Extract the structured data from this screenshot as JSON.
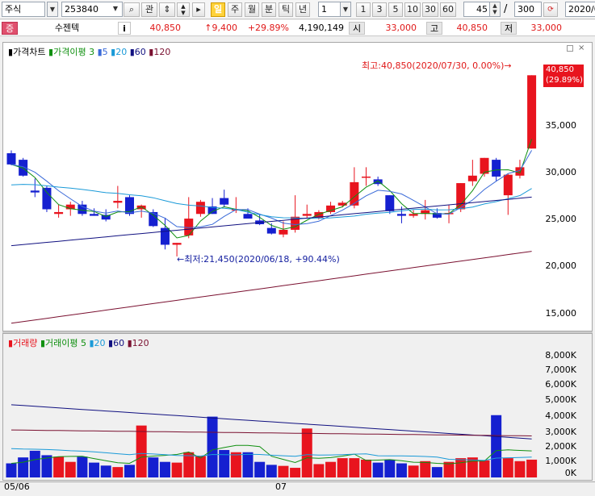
{
  "toolbar": {
    "market": "주식",
    "code": "253840",
    "btn_gwan": "관",
    "periods": [
      "일",
      "주",
      "월",
      "분",
      "틱",
      "년"
    ],
    "interval_value": "1",
    "minute_options": [
      "1",
      "3",
      "5",
      "10",
      "30",
      "60"
    ],
    "count_value": "45",
    "slash": "/",
    "total_value": "300",
    "date_value": "2020/0"
  },
  "info": {
    "tag": "증",
    "name": "수젠텍",
    "i_label": "i",
    "price": "40,850",
    "change": "↑9,400",
    "change_pct": "+29.89%",
    "volume": "4,190,149",
    "open_label": "시",
    "open": "33,000",
    "high_label": "고",
    "high": "40,850",
    "low_label": "저",
    "low": "33,000"
  },
  "price_panel": {
    "legend_title": "가격차트",
    "legend_ma": "가격이평",
    "legend_periods": [
      "3",
      "5",
      "20",
      "60",
      "120"
    ],
    "high_annotation": "최고:40,850(2020/07/30, 0.00%)→",
    "low_annotation": "←최저:21,450(2020/06/18, +90.44%)",
    "current_price_tag": "40,850",
    "current_pct_tag": "(29.89%)",
    "y_ticks": [
      "35,000",
      "30,000",
      "25,000",
      "20,000",
      "15,000"
    ]
  },
  "volume_panel": {
    "legend_title": "거래량",
    "legend_ma": "거래이평",
    "legend_periods": [
      "5",
      "20",
      "60",
      "120"
    ],
    "y_ticks": [
      "8,000K",
      "7,000K",
      "6,000K",
      "5,000K",
      "4,000K",
      "3,000K",
      "2,000K",
      "1,000K",
      "0K"
    ]
  },
  "x_axis": {
    "labels": [
      "05/06",
      "07"
    ]
  },
  "colors": {
    "up": "#e8141e",
    "down": "#1520d0",
    "ma3": "#109010",
    "ma5": "#3a6ad8",
    "ma20": "#1a9ad8",
    "ma60": "#101080",
    "ma120": "#7a1030"
  },
  "chart_data": {
    "type": "candlestick",
    "title": "가격차트",
    "ylim": [
      13500,
      42000
    ],
    "x": [
      "05/06",
      "",
      "",
      "",
      "",
      "",
      "",
      "",
      "",
      "",
      "",
      "",
      "",
      "",
      "",
      "",
      "",
      "",
      "",
      "",
      "",
      "",
      "",
      "",
      "07",
      "",
      "",
      "",
      "",
      "",
      "",
      "",
      "",
      "",
      "",
      "",
      "",
      "",
      "",
      "",
      "",
      "",
      "",
      "",
      ""
    ],
    "ohlc": [
      [
        32500,
        32800,
        31200,
        31300
      ],
      [
        31800,
        32000,
        30000,
        30100
      ],
      [
        28500,
        29800,
        27800,
        28300
      ],
      [
        28800,
        29000,
        26200,
        26500
      ],
      [
        26000,
        27000,
        25600,
        26200
      ],
      [
        26500,
        27300,
        25800,
        27000
      ],
      [
        27000,
        27400,
        25800,
        26000
      ],
      [
        26000,
        26600,
        25800,
        25800
      ],
      [
        25900,
        26500,
        25200,
        25400
      ],
      [
        27200,
        29000,
        26600,
        27400
      ],
      [
        27800,
        28000,
        25800,
        26000
      ],
      [
        26500,
        27000,
        25600,
        26900
      ],
      [
        26200,
        26500,
        24600,
        24700
      ],
      [
        24500,
        25600,
        22200,
        22700
      ],
      [
        22700,
        22900,
        21450,
        22900
      ],
      [
        23700,
        27800,
        23400,
        25500
      ],
      [
        26000,
        27500,
        25700,
        27300
      ],
      [
        26800,
        27700,
        26000,
        26000
      ],
      [
        27700,
        28600,
        26700,
        27000
      ],
      [
        26400,
        27800,
        26100,
        26500
      ],
      [
        26000,
        26600,
        25500,
        25500
      ],
      [
        25300,
        26000,
        24800,
        24900
      ],
      [
        24500,
        25000,
        23800,
        23900
      ],
      [
        23800,
        25200,
        23500,
        24300
      ],
      [
        24300,
        28000,
        24000,
        25700
      ],
      [
        25800,
        27000,
        25600,
        26000
      ],
      [
        25600,
        26400,
        25400,
        26200
      ],
      [
        26200,
        27300,
        26000,
        26900
      ],
      [
        26900,
        27400,
        26700,
        27200
      ],
      [
        26900,
        31000,
        26600,
        29400
      ],
      [
        30000,
        31000,
        29000,
        30000
      ],
      [
        29700,
        30000,
        29000,
        29200
      ],
      [
        28000,
        28000,
        26000,
        26300
      ],
      [
        26000,
        26800,
        25000,
        25800
      ],
      [
        25800,
        26400,
        25600,
        26000
      ],
      [
        26000,
        27500,
        25400,
        26400
      ],
      [
        26100,
        26600,
        25500,
        25600
      ],
      [
        26000,
        27000,
        25000,
        26100
      ],
      [
        26500,
        29300,
        26200,
        29300
      ],
      [
        29500,
        31800,
        29000,
        30100
      ],
      [
        30300,
        32000,
        30000,
        32000
      ],
      [
        31800,
        32000,
        29500,
        30000
      ],
      [
        28000,
        30300,
        25900,
        30200
      ],
      [
        30100,
        31800,
        29800,
        31000
      ],
      [
        33000,
        40850,
        33000,
        40850
      ]
    ],
    "volume": [
      950,
      1350,
      1800,
      1500,
      1400,
      1050,
      1400,
      1000,
      800,
      700,
      850,
      3500,
      1350,
      1050,
      1000,
      1700,
      1450,
      4100,
      1850,
      1700,
      1700,
      1050,
      850,
      780,
      650,
      3300,
      900,
      1050,
      1300,
      1300,
      1200,
      1000,
      1200,
      950,
      800,
      1100,
      700,
      1050,
      1300,
      1350,
      1150,
      4200,
      1300,
      1100,
      1200
    ]
  },
  "volume_chart_data": {
    "type": "bar",
    "title": "거래량",
    "ylim": [
      0,
      8700
    ],
    "unit": "K",
    "values": [
      950,
      1350,
      1800,
      1500,
      1400,
      1050,
      1400,
      1000,
      800,
      700,
      850,
      3500,
      1350,
      1050,
      1000,
      1700,
      1450,
      4100,
      1850,
      1700,
      1700,
      1050,
      850,
      780,
      650,
      3300,
      900,
      1050,
      1300,
      1300,
      1200,
      1000,
      1200,
      950,
      800,
      1100,
      700,
      1050,
      1300,
      1350,
      1150,
      4200,
      1300,
      1100,
      1200
    ]
  }
}
